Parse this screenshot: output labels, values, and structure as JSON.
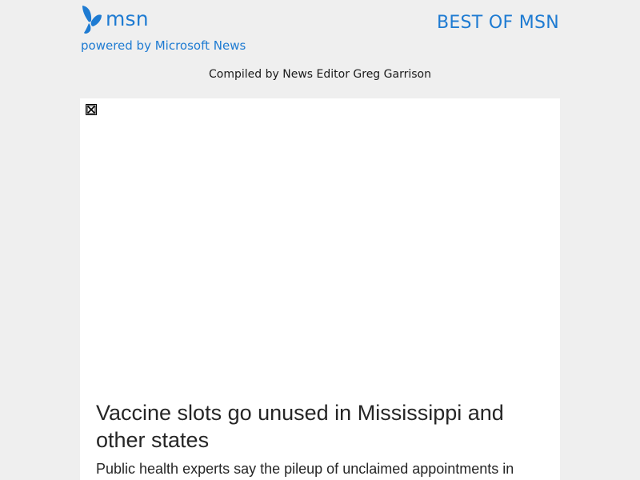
{
  "header": {
    "brand_name": "msn",
    "powered_by": "powered by Microsoft News",
    "section_title": "BEST OF MSN",
    "compiled_by": "Compiled by News Editor Greg Garrison"
  },
  "article": {
    "image_icon": "broken-image-icon",
    "title": "Vaccine slots go unused in Mississippi and other states",
    "summary": "Public health experts say the pileup of unclaimed appointments in"
  },
  "colors": {
    "background": "#efefef",
    "brand_blue": "#1e7bd2",
    "card_background": "#ffffff",
    "text_dark": "#262626"
  }
}
